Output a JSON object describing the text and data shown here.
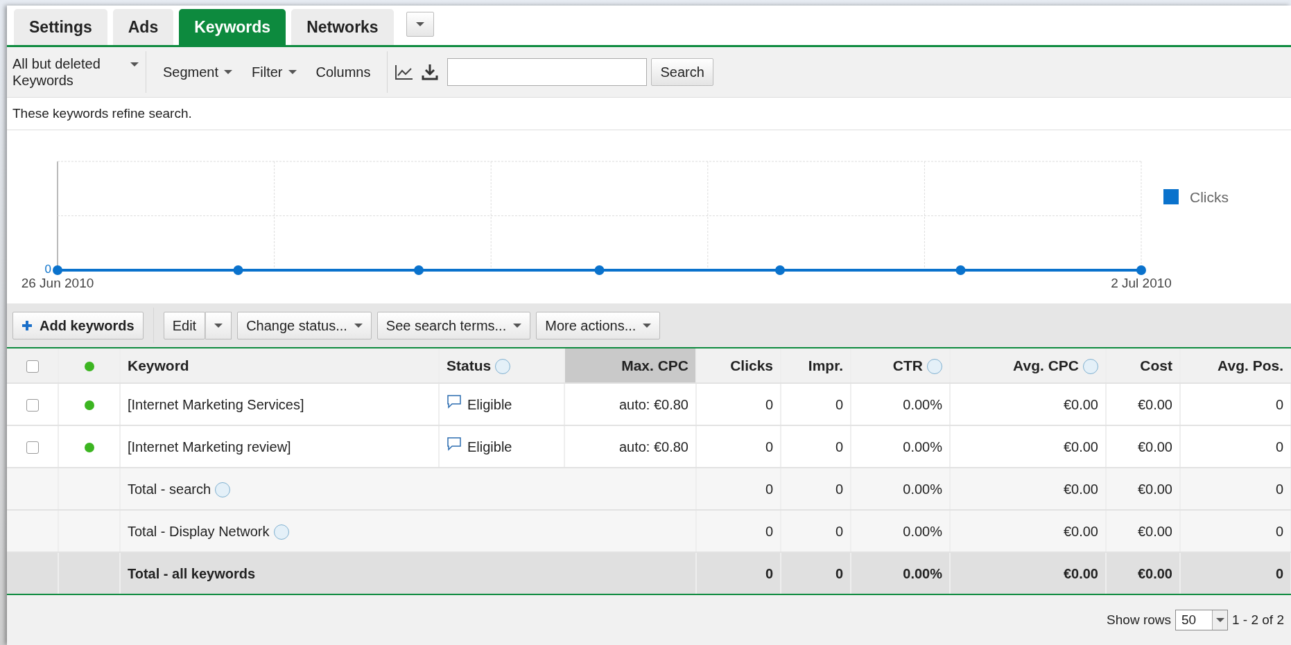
{
  "tabs": [
    {
      "label": "Settings",
      "selected": false
    },
    {
      "label": "Ads",
      "selected": false
    },
    {
      "label": "Keywords",
      "selected": true
    },
    {
      "label": "Networks",
      "selected": false
    }
  ],
  "toolbar": {
    "view_filter": "All but deleted Keywords",
    "menus": [
      {
        "label": "Segment",
        "dropdown": true
      },
      {
        "label": "Filter",
        "dropdown": true
      },
      {
        "label": "Columns",
        "dropdown": false
      }
    ],
    "search_button": "Search"
  },
  "info": "These keywords refine search.",
  "chart": {
    "zero_label": "0",
    "start_date": "26 Jun 2010",
    "end_date": "2 Jul 2010",
    "legend": [
      {
        "name": "Clicks",
        "color": "#0a72cc"
      }
    ]
  },
  "actions": [
    {
      "label": "Add keywords",
      "kind": "add"
    },
    {
      "label": "Edit",
      "kind": "split"
    },
    {
      "label": "Change status...",
      "kind": "dropdown"
    },
    {
      "label": "See search terms...",
      "kind": "dropdown"
    },
    {
      "label": "More actions...",
      "kind": "dropdown"
    }
  ],
  "table": {
    "header_checkbox": {
      "checked": false
    },
    "header_dot": {
      "color": "#3cb521"
    },
    "columns": [
      {
        "label": "Keyword",
        "help": false,
        "sorted": false
      },
      {
        "label": "Status",
        "help": true,
        "sorted": false
      },
      {
        "label": "Max. CPC",
        "help": false,
        "sorted": true
      },
      {
        "label": "Clicks",
        "help": false,
        "sorted": false
      },
      {
        "label": "Impr.",
        "help": false,
        "sorted": false
      },
      {
        "label": "CTR",
        "help": true,
        "sorted": false
      },
      {
        "label": "Avg. CPC",
        "help": true,
        "sorted": false
      },
      {
        "label": "Cost",
        "help": false,
        "sorted": false
      },
      {
        "label": "Avg. Pos.",
        "help": false,
        "sorted": false
      }
    ],
    "rows": [
      {
        "checked": false,
        "color": "#3cb521",
        "cells": [
          "[Internet Marketing Services]",
          "Eligible",
          "auto: €0.80",
          "0",
          "0",
          "0.00%",
          "€0.00",
          "€0.00",
          "0"
        ]
      },
      {
        "checked": false,
        "color": "#3cb521",
        "cells": [
          "[Internet Marketing review]",
          "Eligible",
          "auto: €0.80",
          "0",
          "0",
          "0.00%",
          "€0.00",
          "€0.00",
          "0"
        ]
      }
    ],
    "totals": [
      {
        "label": "Total - search",
        "help": true,
        "kind": "subtotal",
        "cells": [
          "0",
          "0",
          "0.00%",
          "€0.00",
          "€0.00",
          "0"
        ]
      },
      {
        "label": "Total - Display Network",
        "help": true,
        "kind": "subtotal",
        "cells": [
          "0",
          "0",
          "0.00%",
          "€0.00",
          "€0.00",
          "0"
        ]
      },
      {
        "label": "Total - all keywords",
        "help": false,
        "kind": "grand",
        "cells": [
          "0",
          "0",
          "0.00%",
          "€0.00",
          "€0.00",
          "0"
        ]
      }
    ]
  },
  "footer": {
    "show_rows_label": "Show rows",
    "rows_per_page": "50",
    "range": "1 - 2 of 2"
  }
}
